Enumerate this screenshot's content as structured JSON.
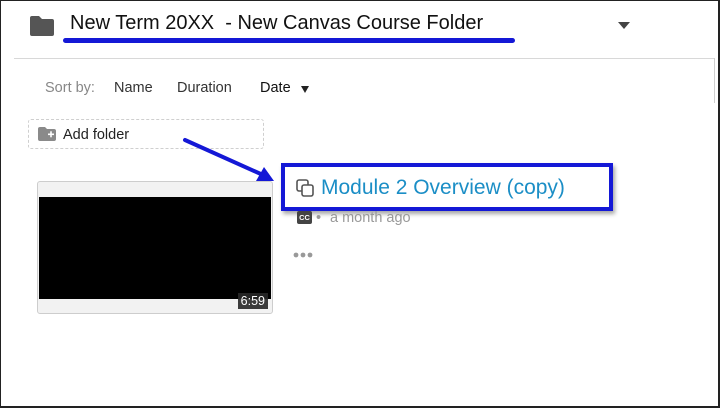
{
  "header": {
    "title": "New Term 20XX  - New Canvas Course Folder",
    "folder_icon": "folder-icon",
    "menu_icon": "caret-down-icon"
  },
  "sort": {
    "label": "Sort by:",
    "options": [
      "Name",
      "Duration",
      "Date"
    ],
    "active": "Date",
    "active_icon": "caret-down-icon"
  },
  "add_folder": {
    "label": "Add folder",
    "icon": "folder-plus-icon"
  },
  "items": [
    {
      "title": "Module 2 Overview (copy)",
      "duration": "6:59",
      "captions_badge": "CC",
      "separator": "•",
      "modified": "a month ago",
      "copy_icon": "copy-icon",
      "more_icon": "more-horizontal-icon"
    }
  ],
  "colors": {
    "annotation_blue": "#1418d6",
    "link_blue": "#1b8ec6",
    "muted_text": "#999999",
    "text": "#222222"
  }
}
